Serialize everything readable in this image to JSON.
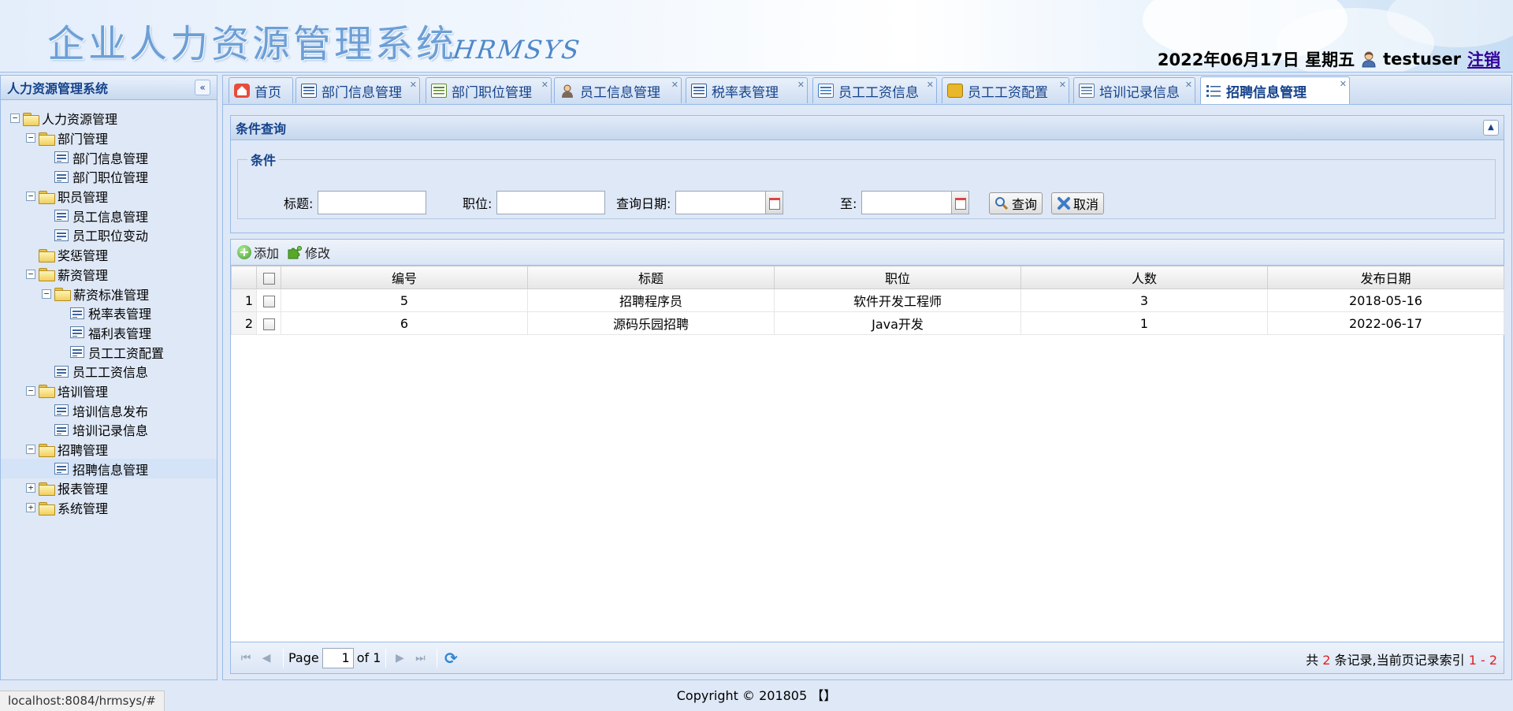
{
  "header": {
    "title": "企业人力资源管理系统",
    "subtitle": "HRMSYS",
    "date": "2022年06月17日 星期五",
    "username": "testuser",
    "logout": "注销"
  },
  "sidebar": {
    "title": "人力资源管理系统",
    "collapse_icon": "«",
    "tree": [
      {
        "label": "人力资源管理",
        "level": 0,
        "type": "folder",
        "exp": "−"
      },
      {
        "label": "部门管理",
        "level": 1,
        "type": "folder",
        "exp": "−"
      },
      {
        "label": "部门信息管理",
        "level": 2,
        "type": "leaf"
      },
      {
        "label": "部门职位管理",
        "level": 2,
        "type": "leaf"
      },
      {
        "label": "职员管理",
        "level": 1,
        "type": "folder",
        "exp": "−"
      },
      {
        "label": "员工信息管理",
        "level": 2,
        "type": "leaf"
      },
      {
        "label": "员工职位变动",
        "level": 2,
        "type": "leaf"
      },
      {
        "label": "奖惩管理",
        "level": 1,
        "type": "folder",
        "exp": ""
      },
      {
        "label": "薪资管理",
        "level": 1,
        "type": "folder",
        "exp": "−"
      },
      {
        "label": "薪资标准管理",
        "level": 2,
        "type": "folder",
        "exp": "−"
      },
      {
        "label": "税率表管理",
        "level": 3,
        "type": "leaf"
      },
      {
        "label": "福利表管理",
        "level": 3,
        "type": "leaf"
      },
      {
        "label": "员工工资配置",
        "level": 3,
        "type": "leaf"
      },
      {
        "label": "员工工资信息",
        "level": 2,
        "type": "leaf"
      },
      {
        "label": "培训管理",
        "level": 1,
        "type": "folder",
        "exp": "−"
      },
      {
        "label": "培训信息发布",
        "level": 2,
        "type": "leaf"
      },
      {
        "label": "培训记录信息",
        "level": 2,
        "type": "leaf"
      },
      {
        "label": "招聘管理",
        "level": 1,
        "type": "folder",
        "exp": "−"
      },
      {
        "label": "招聘信息管理",
        "level": 2,
        "type": "leaf",
        "selected": true
      },
      {
        "label": "报表管理",
        "level": 1,
        "type": "folder",
        "exp": "+"
      },
      {
        "label": "系统管理",
        "level": 1,
        "type": "folder",
        "exp": "+"
      }
    ]
  },
  "tabs": [
    {
      "label": "首页",
      "icon": "home-icon",
      "closable": false
    },
    {
      "label": "部门信息管理",
      "icon": "monitor-icon",
      "closable": true
    },
    {
      "label": "部门职位管理",
      "icon": "id-card-icon",
      "closable": true
    },
    {
      "label": "员工信息管理",
      "icon": "person-icon",
      "closable": true
    },
    {
      "label": "税率表管理",
      "icon": "list-icon",
      "closable": true
    },
    {
      "label": "员工工资信息",
      "icon": "table-icon",
      "closable": true
    },
    {
      "label": "员工工资配置",
      "icon": "wallet-icon",
      "closable": true
    },
    {
      "label": "培训记录信息",
      "icon": "grid-icon",
      "closable": true
    },
    {
      "label": "招聘信息管理",
      "icon": "bullet-list-icon",
      "closable": true,
      "active": true
    }
  ],
  "query": {
    "title": "条件查询",
    "legend": "条件",
    "title_label": "标题:",
    "title_value": "",
    "position_label": "职位:",
    "position_value": "",
    "date_label": "查询日期:",
    "date_from": "",
    "to_label": "至:",
    "date_to": "",
    "search_button": "查询",
    "cancel_button": "取消"
  },
  "toolbar": {
    "add": "添加",
    "edit": "修改"
  },
  "grid": {
    "columns": [
      "编号",
      "标题",
      "职位",
      "人数",
      "发布日期"
    ],
    "rows": [
      {
        "rownum": "1",
        "cells": [
          "5",
          "招聘程序员",
          "软件开发工程师",
          "3",
          "2018-05-16"
        ]
      },
      {
        "rownum": "2",
        "cells": [
          "6",
          "源码乐园招聘",
          "Java开发",
          "1",
          "2022-06-17"
        ]
      }
    ]
  },
  "pager": {
    "page_label": "Page",
    "page_value": "1",
    "of_label": "of 1",
    "info_prefix": "共",
    "total": "2",
    "info_mid": "条记录,当前页记录索引",
    "range": "1 - 2"
  },
  "footer": {
    "copyright": "Copyright © 201805 【】"
  },
  "status_bar": {
    "url": "localhost:8084/hrmsys/#"
  },
  "colors": {
    "accent": "#15428b",
    "border": "#99bbe8",
    "panel_bg": "#dfe8f6",
    "highlight_red": "#e02020"
  }
}
